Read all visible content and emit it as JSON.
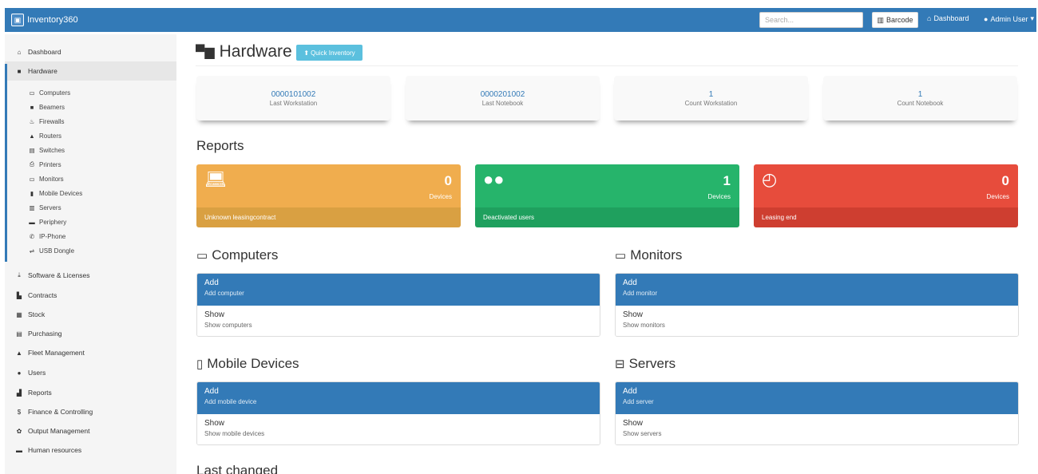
{
  "navbar": {
    "brand": "Inventory360",
    "search_placeholder": "Search...",
    "barcode_label": "Barcode",
    "dashboard_label": "Dashboard",
    "user_label": "Admin User"
  },
  "sidebar": {
    "items": [
      {
        "label": "Dashboard",
        "icon": "home-icon"
      },
      {
        "label": "Hardware",
        "icon": "hardware-icon"
      },
      {
        "label": "Software & Licenses",
        "icon": "download-icon"
      },
      {
        "label": "Contracts",
        "icon": "contract-icon"
      },
      {
        "label": "Stock",
        "icon": "stock-icon"
      },
      {
        "label": "Purchasing",
        "icon": "purchasing-icon"
      },
      {
        "label": "Fleet Management",
        "icon": "car-icon"
      },
      {
        "label": "Users",
        "icon": "user-icon"
      },
      {
        "label": "Reports",
        "icon": "chart-icon"
      },
      {
        "label": "Finance & Controlling",
        "icon": "dollar-icon"
      },
      {
        "label": "Output Management",
        "icon": "output-icon"
      },
      {
        "label": "Human resources",
        "icon": "briefcase-icon"
      }
    ],
    "hardware_sub": [
      {
        "label": "Computers",
        "icon": "laptop-icon"
      },
      {
        "label": "Beamers",
        "icon": "video-icon"
      },
      {
        "label": "Firewalls",
        "icon": "fire-icon"
      },
      {
        "label": "Routers",
        "icon": "router-icon"
      },
      {
        "label": "Switches",
        "icon": "switch-icon"
      },
      {
        "label": "Printers",
        "icon": "printer-icon"
      },
      {
        "label": "Monitors",
        "icon": "monitor-icon"
      },
      {
        "label": "Mobile Devices",
        "icon": "mobile-icon"
      },
      {
        "label": "Servers",
        "icon": "server-icon"
      },
      {
        "label": "Periphery",
        "icon": "keyboard-icon"
      },
      {
        "label": "IP-Phone",
        "icon": "phone-icon"
      },
      {
        "label": "USB Dongle",
        "icon": "usb-icon"
      }
    ]
  },
  "main": {
    "title": "Hardware",
    "quick_inventory_label": "Quick Inventory",
    "stats": [
      {
        "value": "0000101002",
        "label": "Last Workstation"
      },
      {
        "value": "0000201002",
        "label": "Last Notebook"
      },
      {
        "value": "1",
        "label": "Count Workstation"
      },
      {
        "value": "1",
        "label": "Count Notebook"
      }
    ],
    "reports_heading": "Reports",
    "reports": [
      {
        "count": "0",
        "count_label": "Devices",
        "footer": "Unknown leasingcontract",
        "color": "#f0ad4e",
        "footer_color": "#d9a042",
        "icon": "laptop-icon"
      },
      {
        "count": "1",
        "count_label": "Devices",
        "footer": "Deactivated users",
        "color": "#26b46b",
        "footer_color": "#1fa05e",
        "icon": "users-icon"
      },
      {
        "count": "0",
        "count_label": "Devices",
        "footer": "Leasing end",
        "color": "#e74c3c",
        "footer_color": "#ce3e30",
        "icon": "clock-icon"
      }
    ],
    "sections": [
      {
        "heading": "Computers",
        "icon": "laptop-icon",
        "add": "Add",
        "add_sub": "Add computer",
        "show": "Show",
        "show_sub": "Show computers"
      },
      {
        "heading": "Monitors",
        "icon": "monitor-icon",
        "add": "Add",
        "add_sub": "Add monitor",
        "show": "Show",
        "show_sub": "Show monitors"
      },
      {
        "heading": "Mobile Devices",
        "icon": "mobile-icon",
        "add": "Add",
        "add_sub": "Add mobile device",
        "show": "Show",
        "show_sub": "Show mobile devices"
      },
      {
        "heading": "Servers",
        "icon": "server-icon",
        "add": "Add",
        "add_sub": "Add server",
        "show": "Show",
        "show_sub": "Show servers"
      }
    ],
    "last_changed_heading": "Last changed"
  }
}
